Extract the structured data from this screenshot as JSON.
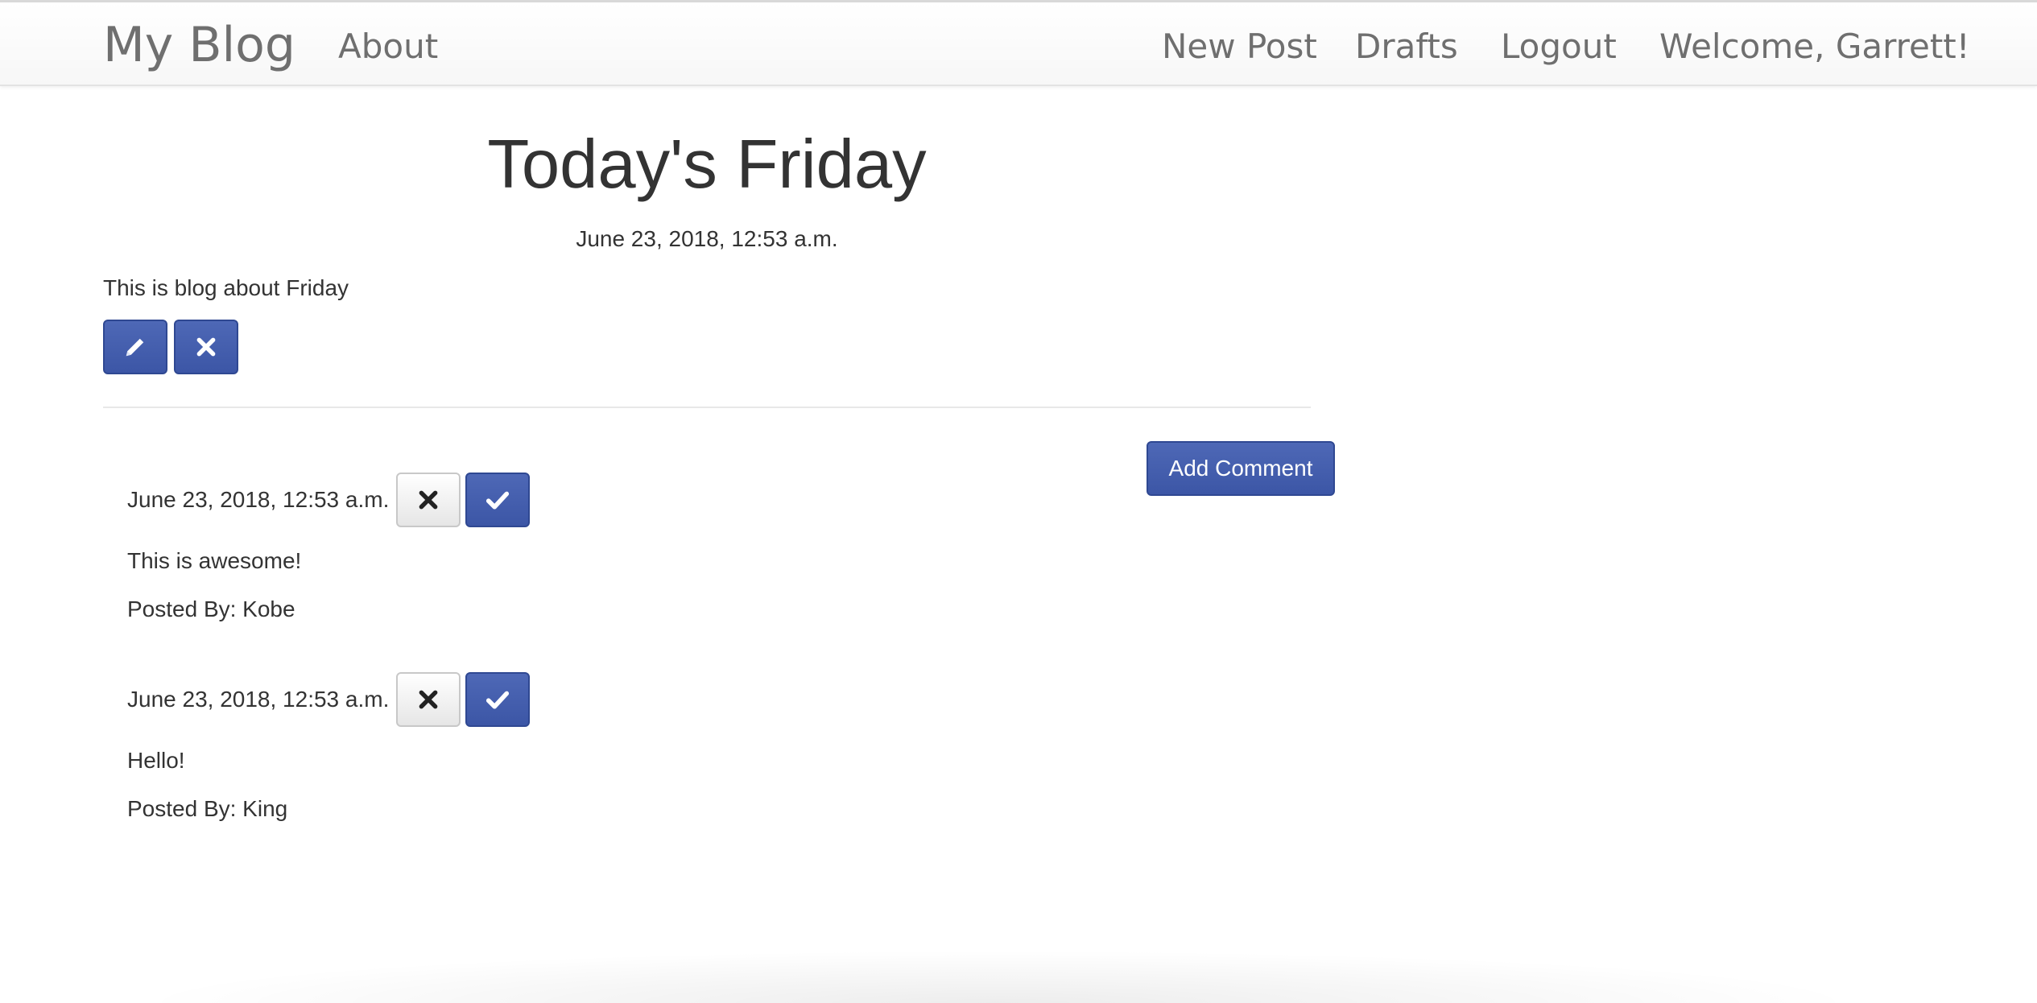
{
  "navbar": {
    "brand": "My Blog",
    "about": "About",
    "new_post": "New Post",
    "drafts": "Drafts",
    "logout": "Logout",
    "welcome": "Welcome, Garrett!"
  },
  "post": {
    "title": "Today's Friday",
    "date": "June 23, 2018, 12:53 a.m.",
    "body": "This is blog about Friday",
    "edit_icon": "pencil-icon",
    "delete_icon": "times-icon"
  },
  "add_comment_label": "Add Comment",
  "comments": [
    {
      "date": "June 23, 2018, 12:53 a.m.",
      "text": "This is awesome!",
      "posted_by": "Posted By: Kobe",
      "remove_icon": "times-icon",
      "approve_icon": "check-icon"
    },
    {
      "date": "June 23, 2018, 12:53 a.m.",
      "text": "Hello!",
      "posted_by": "Posted By: King",
      "remove_icon": "times-icon",
      "approve_icon": "check-icon"
    }
  ],
  "colors": {
    "primary_button": "#4260ae",
    "nav_text": "#6f6f6f",
    "body_text": "#333333"
  }
}
